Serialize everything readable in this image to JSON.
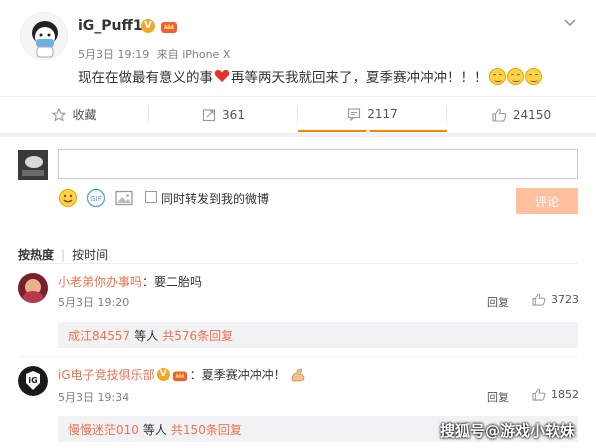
{
  "post": {
    "username": "iG_Puff1",
    "verified_badge": "V",
    "date": "5月3日 19:19",
    "source": "来自 iPhone X",
    "text_before_heart": "现在在做最有意义的事",
    "text_after_heart": "再等两天我就回来了，夏季赛冲冲冲！！！",
    "heart_color": "#e8302c"
  },
  "actions": [
    {
      "label": "收藏",
      "icon": "star-icon"
    },
    {
      "label": "361",
      "icon": "share-icon"
    },
    {
      "label": "2117",
      "icon": "comment-icon"
    },
    {
      "label": "24150",
      "icon": "like-icon"
    }
  ],
  "compose": {
    "forward_label": "同时转发到我的微博",
    "submit_label": "评论",
    "submit_color": "#ffc09f"
  },
  "sort": {
    "by_hot": "按热度",
    "by_time": "按时间"
  },
  "comments": [
    {
      "user": "小老弟你办事吗",
      "text": "：要二胎吗",
      "time": "5月3日 19:20",
      "reply_label": "回复",
      "likes": "3723",
      "sub_user": "成江84557",
      "sub_mid": "等人",
      "sub_link": "共576条回复"
    },
    {
      "user": "iG电子竞技俱乐部",
      "badge": "V",
      "text": "：夏季赛冲冲冲！",
      "time": "5月3日 19:34",
      "reply_label": "回复",
      "likes": "1852",
      "sub_user": "慢慢迷茫010",
      "sub_mid": "等人",
      "sub_link": "共150条回复"
    }
  ],
  "watermark": "搜狐号@游戏小软妹",
  "accent_color": "#ff8200",
  "link_color": "#eb7350"
}
